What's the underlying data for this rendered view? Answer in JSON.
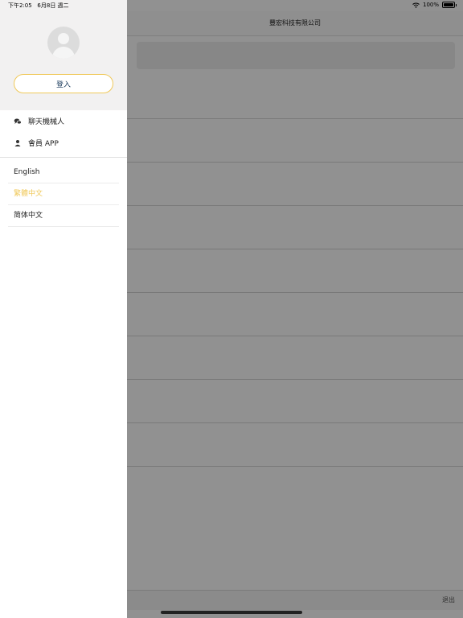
{
  "status_bar": {
    "time": "下午2:05",
    "date": "6月8日 週二",
    "battery": "100%"
  },
  "app": {
    "title": "豐宏科技有限公司",
    "logout_label": "退出"
  },
  "drawer": {
    "login_label": "登入",
    "menu_items": [
      {
        "label": "聊天機械人",
        "icon": "chat-icon"
      },
      {
        "label": "會員 APP",
        "icon": "person-icon"
      }
    ],
    "languages": [
      {
        "label": "English",
        "active": false
      },
      {
        "label": "繁體中文",
        "active": true
      },
      {
        "label": "简体中文",
        "active": false
      }
    ]
  },
  "colors": {
    "accent": "#f0c95a",
    "login_text": "#1a3a5c",
    "drawer_header_bg": "#f2f1f1"
  }
}
